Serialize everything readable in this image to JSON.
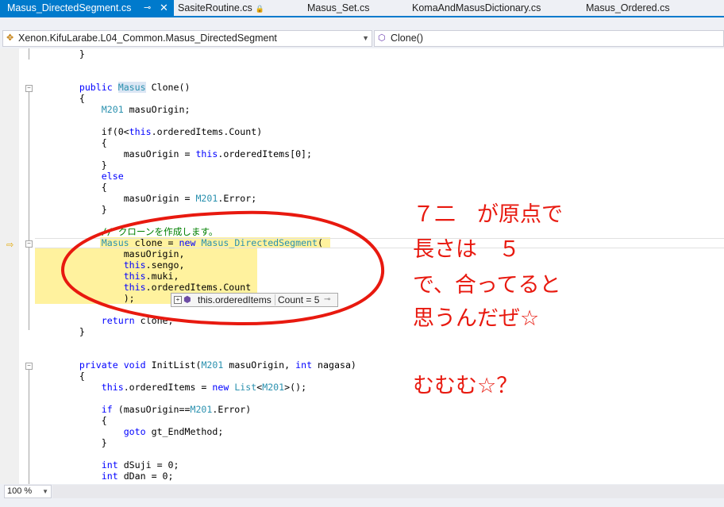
{
  "tabs": [
    {
      "label": "Masus_DirectedSegment.cs",
      "active": true
    },
    {
      "label": "SasiteRoutine.cs",
      "locked": true
    },
    {
      "label": "Masus_Set.cs"
    },
    {
      "label": "KomaAndMasusDictionary.cs"
    },
    {
      "label": "Masus_Ordered.cs"
    }
  ],
  "nav": {
    "type_path": "Xenon.KifuLarabe.L04_Common.Masus_DirectedSegment",
    "member": "Clone()"
  },
  "code": {
    "l01": "}",
    "l02a": "public ",
    "l02b": "Masus",
    "l02c": " Clone()",
    "l03": "{",
    "l04a": "M201",
    "l04b": " masuOrigin;",
    "l05a": "if(0<",
    "l05b": "this",
    "l05c": ".orderedItems.Count)",
    "l06": "{",
    "l07a": "masuOrigin = ",
    "l07b": "this",
    "l07c": ".orderedItems[0];",
    "l08": "}",
    "l09": "else",
    "l10": "{",
    "l11a": "masuOrigin = ",
    "l11b": "M201",
    "l11c": ".Error;",
    "l12": "}",
    "l13": "// クローンを作成します。",
    "l14a": "Masus",
    "l14b": " clone = ",
    "l14c": "new",
    "l14d": " ",
    "l14e": "Masus_DirectedSegment",
    "l14f": "(",
    "l15": "masuOrigin,",
    "l16a": "this",
    "l16b": ".sengo,",
    "l17a": "this",
    "l17b": ".muki,",
    "l18a": "this",
    "l18b": ".orderedItems.Count",
    "l19": ");",
    "l20a": "return",
    "l20b": " clone;",
    "l21": "}",
    "l22a": "private",
    "l22b": " ",
    "l22c": "void",
    "l22d": " InitList(",
    "l22e": "M201",
    "l22f": " masuOrigin, ",
    "l22g": "int",
    "l22h": " nagasa)",
    "l23": "{",
    "l24a": "this",
    "l24b": ".orderedItems = ",
    "l24c": "new",
    "l24d": " ",
    "l24e": "List",
    "l24f": "<",
    "l24g": "M201",
    "l24h": ">();",
    "l25a": "if",
    "l25b": " (masuOrigin==",
    "l25c": "M201",
    "l25d": ".Error)",
    "l26": "{",
    "l27a": "goto",
    "l27b": " gt_EndMethod;",
    "l28": "}",
    "l29a": "int",
    "l29b": " dSuji = 0;",
    "l30a": "int",
    "l30b": " dDan = 0;"
  },
  "datatip": {
    "expression": "this.orderedItems",
    "value": "Count = 5"
  },
  "annotation": {
    "lines": [
      "７二　が原点で",
      "長さは　５",
      "で、合ってると",
      "思うんだぜ☆",
      "",
      "むむむ☆？"
    ],
    "color": "#e8190f"
  },
  "zoom": "100 %",
  "colors": {
    "accent": "#007acc",
    "keyword": "#0000ff",
    "type": "#2b91af",
    "comment": "#008000",
    "highlight": "#fff29e"
  }
}
